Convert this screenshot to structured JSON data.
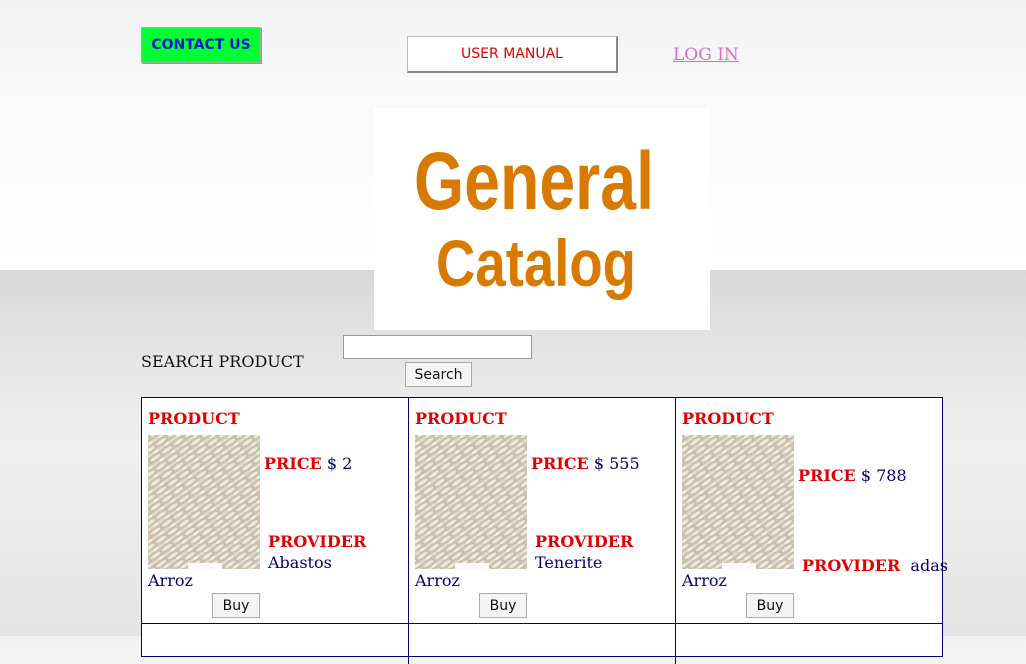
{
  "header": {
    "contact_label": "CONTACT US",
    "manual_label": "USER MANUAL",
    "login_label": "LOG IN"
  },
  "logo": {
    "line1": "General",
    "line2": "Catalog",
    "color": "#d97a00"
  },
  "search": {
    "label": "SEARCH PRODUCT",
    "button_label": "Search",
    "value": ""
  },
  "products": [
    {
      "title": "PRODUCT",
      "price_label": "PRICE",
      "price_value": "$ 2",
      "provider_label": "PROVIDER",
      "provider_value": "Abastos",
      "name": "Arroz",
      "buy_label": "Buy"
    },
    {
      "title": "PRODUCT",
      "price_label": "PRICE",
      "price_value": "$ 555",
      "provider_label": "PROVIDER",
      "provider_value": "Tenerite",
      "name": "Arroz",
      "buy_label": "Buy"
    },
    {
      "title": "PRODUCT",
      "price_label": "PRICE",
      "price_value": "$ 788",
      "provider_label": "PROVIDER",
      "provider_value": "adas",
      "name": "Arroz",
      "buy_label": "Buy"
    }
  ],
  "colors": {
    "contact_bg": "#00ff33",
    "contact_text": "#0019c9",
    "accent_red": "#e00000",
    "navy": "#00006e",
    "login_link": "#d070c8"
  }
}
